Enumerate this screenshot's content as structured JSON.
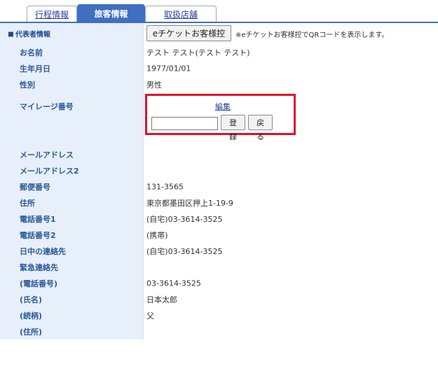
{
  "tabs": [
    {
      "label": "行程情報",
      "active": false
    },
    {
      "label": "旅客情報",
      "active": true
    },
    {
      "label": "取扱店舗",
      "active": false
    }
  ],
  "section": {
    "title": "代表者情報",
    "eticket_button": "eチケットお客様控",
    "eticket_note": "※eチケットお客様控でQRコードを表示します。"
  },
  "fields": {
    "name": {
      "label": "お名前",
      "value": "テスト テスト(テスト テスト)"
    },
    "birthdate": {
      "label": "生年月日",
      "value": "1977/01/01"
    },
    "gender": {
      "label": "性別",
      "value": "男性"
    },
    "mileage": {
      "label": "マイレージ番号",
      "edit_link": "編集",
      "input_value": "",
      "register_button": "登録",
      "back_button": "戻る"
    },
    "email": {
      "label": "メールアドレス",
      "value": ""
    },
    "email2": {
      "label": "メールアドレス2",
      "value": ""
    },
    "postal": {
      "label": "郵便番号",
      "value": "131-3565"
    },
    "address": {
      "label": "住所",
      "value": "東京都墨田区押上1-19-9"
    },
    "phone1": {
      "label": "電話番号1",
      "value": "(自宅)03-3614-3525"
    },
    "phone2": {
      "label": "電話番号2",
      "value": "(携帯)"
    },
    "daytime": {
      "label": "日中の連絡先",
      "value": "(自宅)03-3614-3525"
    },
    "emergency": {
      "label": "緊急連絡先",
      "value": ""
    },
    "em_phone": {
      "label": "(電話番号)",
      "value": "03-3614-3525"
    },
    "em_name": {
      "label": "(氏名)",
      "value": "日本太郎"
    },
    "em_relation": {
      "label": "(続柄)",
      "value": "父"
    },
    "em_address": {
      "label": "(住所)",
      "value": ""
    }
  },
  "colors": {
    "accent": "#3f6fc1",
    "label_bg": "#e7effb",
    "highlight": "#e0102e"
  }
}
